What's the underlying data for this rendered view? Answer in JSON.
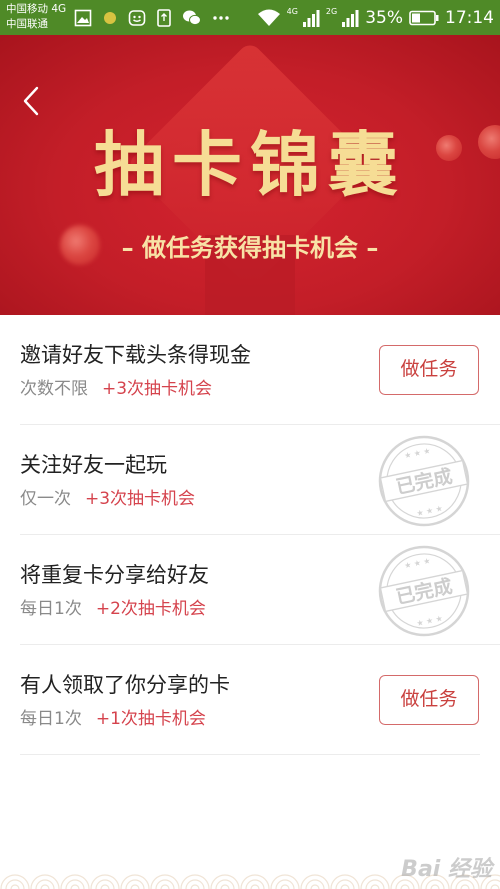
{
  "status_bar": {
    "carrier1": "中国移动 4G",
    "carrier2": "中国联通",
    "net1": "4G",
    "net2": "2G",
    "battery": "35%",
    "time": "17:14",
    "icons": [
      "gallery-icon",
      "dot-icon",
      "emoji-icon",
      "sim-icon",
      "wechat-icon",
      "more-icon",
      "wifi-icon",
      "signal-icon",
      "battery-icon"
    ]
  },
  "banner": {
    "title": "抽卡锦囊",
    "subtitle": "– 做任务获得抽卡机会 –",
    "back_icon": "chevron-left-icon",
    "colors": {
      "bg": "#c31e28",
      "title": "#f6dd95"
    }
  },
  "tasks": [
    {
      "title": "邀请好友下载头条得现金",
      "frequency": "次数不限",
      "reward": "+3次抽卡机会",
      "status": "todo",
      "button": "做任务"
    },
    {
      "title": "关注好友一起玩",
      "frequency": "仅一次",
      "reward": "+3次抽卡机会",
      "status": "done",
      "stamp": "已完成"
    },
    {
      "title": "将重复卡分享给好友",
      "frequency": "每日1次",
      "reward": "+2次抽卡机会",
      "status": "done",
      "stamp": "已完成"
    },
    {
      "title": "有人领取了你分享的卡",
      "frequency": "每日1次",
      "reward": "+1次抽卡机会",
      "status": "todo",
      "button": "做任务"
    }
  ],
  "watermark": "Bai 经验",
  "colors": {
    "accent": "#d5434d",
    "status_bar": "#4f8a27"
  }
}
